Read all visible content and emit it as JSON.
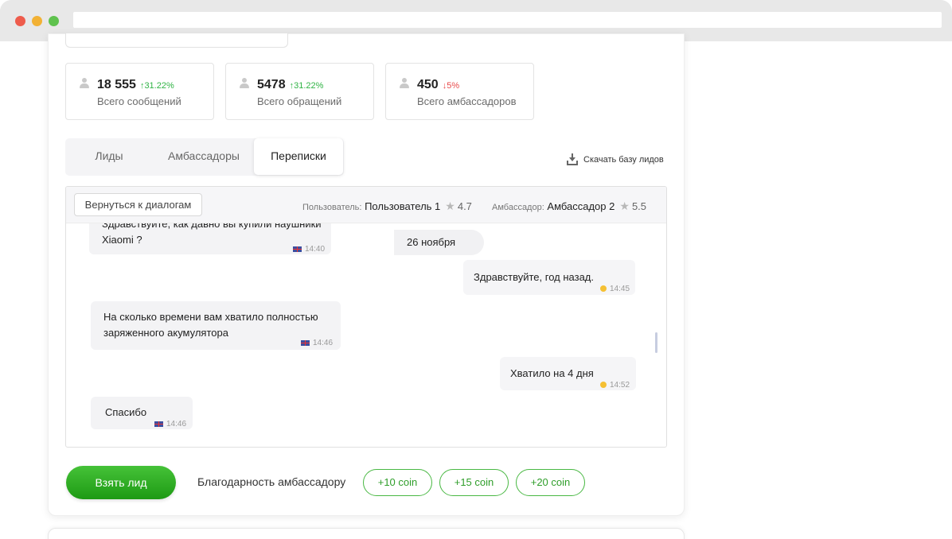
{
  "stats": [
    {
      "value": "18 555",
      "delta": "↑31.22%",
      "label": "Всего сообщений"
    },
    {
      "value": "5478",
      "delta": "↑31.22%",
      "label": "Всего обращений"
    },
    {
      "value": "450",
      "delta": "↓5%",
      "label": "Всего амбассадоров"
    }
  ],
  "tabs": {
    "leads": "Лиды",
    "ambassadors": "Амбассадоры",
    "chats": "Переписки"
  },
  "download_label": "Скачать базу лидов",
  "chat": {
    "back_label": "Вернуться к диалогам",
    "user_key": "Пользователь:",
    "user_name": "Пользователь 1",
    "user_rating": "4.7",
    "amb_key": "Амбассадор:",
    "amb_name": "Амбассадор 2",
    "amb_rating": "5.5",
    "date": "26 ноября",
    "messages": [
      {
        "line1": "Здравствуйте, как давно вы купили наушники",
        "line2": "Xiaomi ?",
        "time": "14:40"
      },
      {
        "line1": "Здравствуйте, год назад.",
        "time": "14:45"
      },
      {
        "line1": "На сколько времени вам хватило полностью",
        "line2": "заряженного акумулятора",
        "time": "14:46"
      },
      {
        "line1": "Хватило на 4 дня",
        "time": "14:52"
      },
      {
        "line1": "Спасибо",
        "time": "14:46"
      }
    ]
  },
  "actions": {
    "take_label": "Взять лид",
    "thanks_label": "Благодарность амбассадору",
    "coins": [
      "+10 coin",
      "+15 coin",
      "+20 coin"
    ]
  },
  "colors": {
    "accent": "#2fb344",
    "down": "#e84a4a",
    "button": "#2a9f1f"
  }
}
